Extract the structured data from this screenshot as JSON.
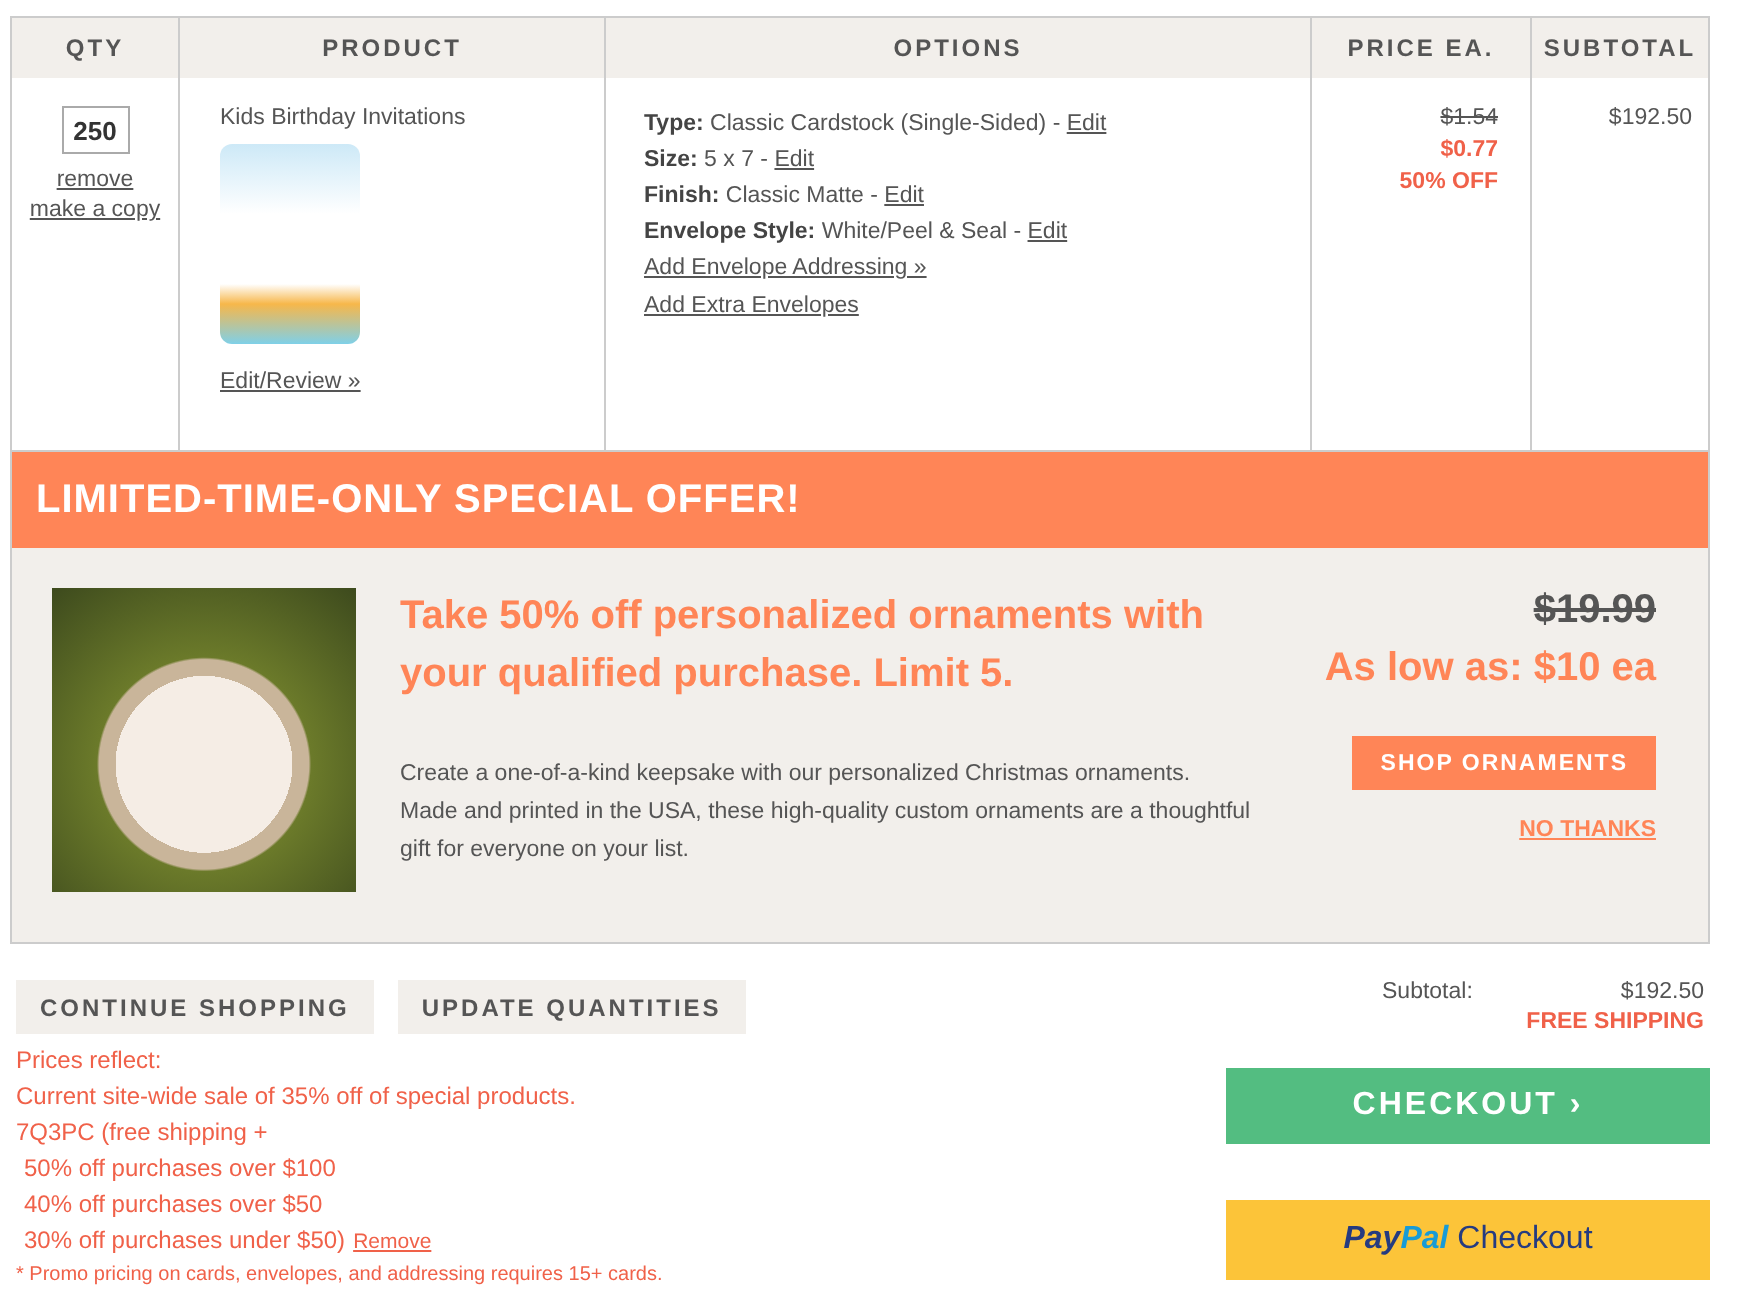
{
  "cart": {
    "columns": [
      "QTY",
      "PRODUCT",
      "OPTIONS",
      "PRICE EA.",
      "SUBTOTAL"
    ],
    "items": [
      {
        "qty": "250",
        "actions": [
          "remove",
          "make a copy"
        ],
        "product": {
          "name": "Kids Birthday Invitations",
          "edit_link": "Edit/Review »"
        },
        "options": [
          {
            "label": "Type:",
            "value": "Classic Cardstock (Single-Sided) -",
            "edit": "Edit"
          },
          {
            "label": "Size:",
            "value": "5 x 7 -",
            "edit": "Edit"
          },
          {
            "label": "Finish:",
            "value": "Classic Matte -",
            "edit": "Edit"
          },
          {
            "label": "Envelope Style:",
            "value": "White/Peel & Seal -",
            "edit": "Edit"
          }
        ],
        "option_links": [
          "Add Envelope Addressing »",
          "Add Extra Envelopes"
        ],
        "price": {
          "original": "$1.54",
          "sale": "$0.77",
          "discount": "50% OFF"
        },
        "subtotal": "$192.50"
      }
    ]
  },
  "offer": {
    "banner": "LIMITED-TIME-ONLY SPECIAL OFFER!",
    "headline": "Take 50% off personalized ornaments with your qualified purchase. Limit 5.",
    "description": "Create a one-of-a-kind keepsake with our personalized Christmas ornaments. Made and printed in the USA, these high-quality custom ornaments are a thoughtful gift for everyone on your list.",
    "original_price": "$19.99",
    "price": "As low as: $10 ea",
    "shop_button": "SHOP ORNAMENTS",
    "decline_link": "NO THANKS"
  },
  "buttons": [
    "CONTINUE SHOPPING",
    "UPDATE QUANTITIES"
  ],
  "promo": {
    "lines": [
      {
        "text": "Prices reflect:",
        "indent": false
      },
      {
        "text": "Current site-wide sale of 35% off of special products.",
        "indent": false
      },
      {
        "text": "7Q3PC (free shipping +",
        "indent": false
      },
      {
        "text": "50% off purchases over $100",
        "indent": true
      },
      {
        "text": "40% off purchases over $50",
        "indent": true
      },
      {
        "text": "30% off purchases under $50)",
        "indent": true
      }
    ],
    "remove_link": "Remove",
    "footnote": "* Promo pricing on cards, envelopes, and addressing requires 15+ cards."
  },
  "summary": {
    "subtotal_label": "Subtotal:",
    "subtotal": "$192.50",
    "shipping": "FREE SHIPPING"
  },
  "checkout_button": "CHECKOUT ›",
  "paypal": {
    "brand_left": "Pay",
    "brand_right": "Pal",
    "label": "Checkout"
  }
}
